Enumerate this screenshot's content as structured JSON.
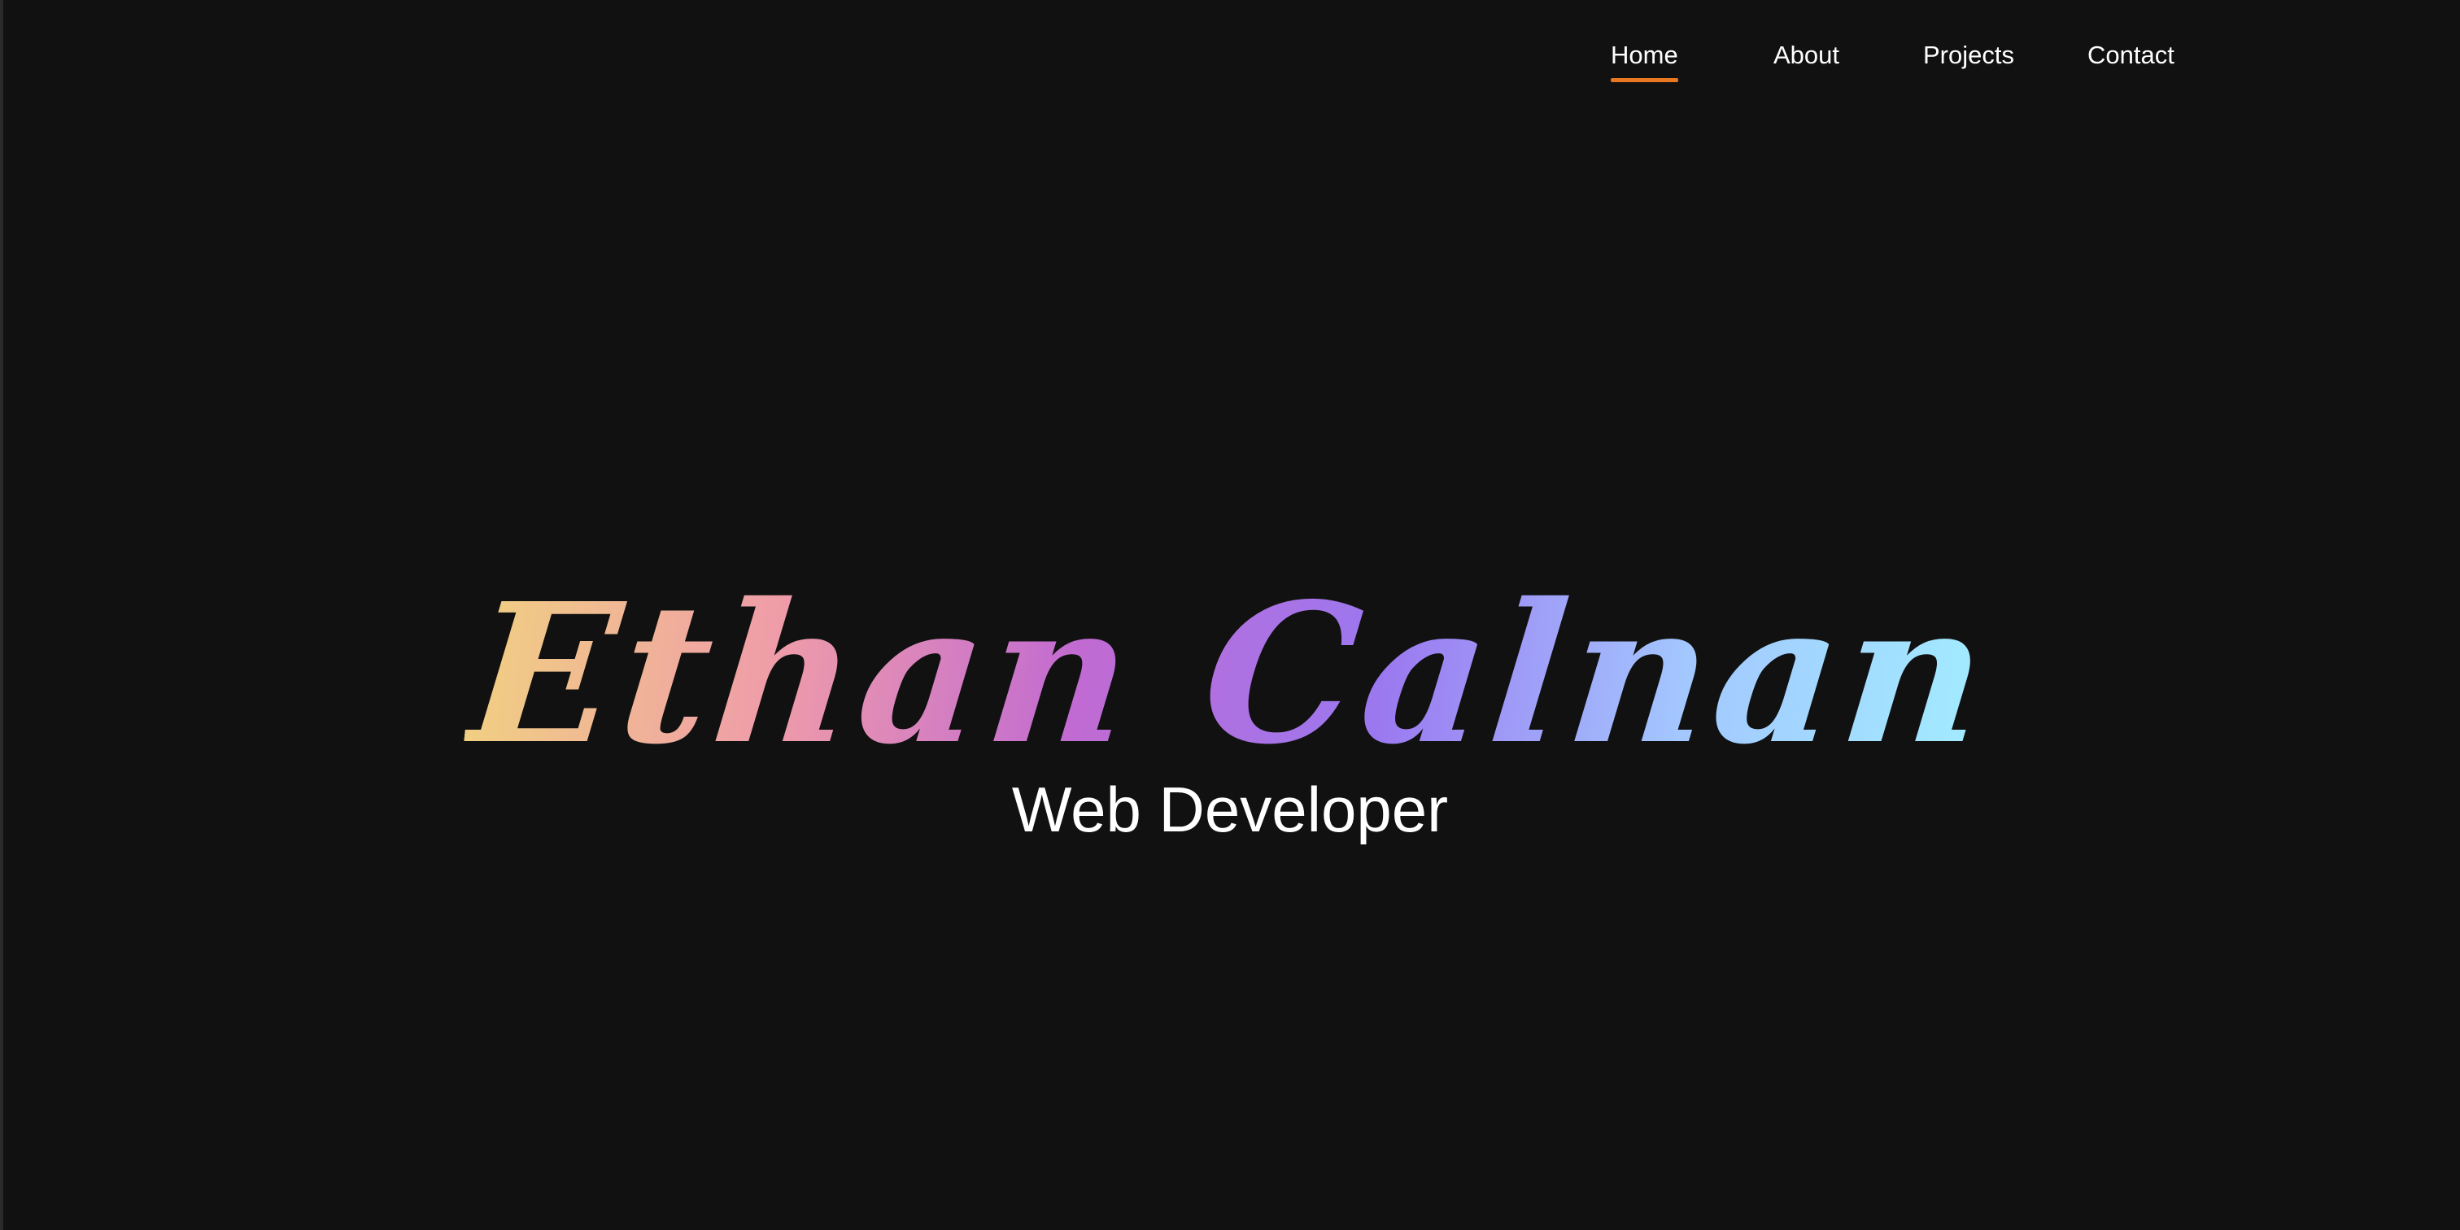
{
  "nav": {
    "items": [
      {
        "label": "Home",
        "active": true
      },
      {
        "label": "About",
        "active": false
      },
      {
        "label": "Projects",
        "active": false
      },
      {
        "label": "Contact",
        "active": false
      }
    ],
    "active_underline_color": "#e87722"
  },
  "hero": {
    "name": "Ethan Calnan",
    "subtitle": "Web Developer",
    "name_gradient_colors": [
      "#f1cf82",
      "#ef9ca9",
      "#c16ad2",
      "#9b78f0",
      "#a3c7ff",
      "#a2ecff"
    ]
  }
}
